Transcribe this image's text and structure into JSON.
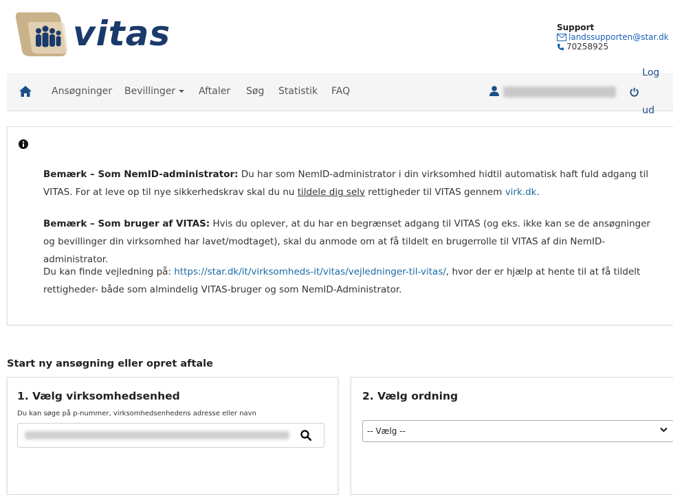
{
  "header": {
    "logo_text": "vitas",
    "support": {
      "title": "Support",
      "email": "landssupporten@star.dk",
      "phone": "70258925"
    }
  },
  "nav": {
    "items": [
      "Ansøgninger",
      "Bevillinger",
      "Aftaler",
      "Søg",
      "Statistik",
      "FAQ"
    ],
    "logout": "Log ud"
  },
  "info": {
    "p1_bold": "Bemærk – Som NemID-administrator:",
    "p1_text_a": " Du har som NemID-administrator i din virksomhed hidtil automatisk haft fuld adgang til VITAS. For at leve op til nye sikkerhedskrav skal du nu ",
    "p1_underline": "tildele dig selv",
    "p1_text_b": " rettigheder til VITAS gennem ",
    "p1_link": "virk.dk",
    "p1_end": ".",
    "p2_bold": "Bemærk – Som bruger af VITAS:",
    "p2_text": " Hvis du oplever, at du har en begrænset adgang til VITAS (og eks. ikke kan se de ansøgninger og bevillinger din virksomhed har lavet/modtaget), skal du anmode om at få tildelt en brugerrolle til VITAS af din NemID-administrator.",
    "p3_text_a": "Du kan finde vejledning på: ",
    "p3_link": "https://star.dk/it/virksomheds-it/vitas/vejledninger-til-vitas/",
    "p3_text_b": ", hvor der er hjælp at hente til at få tildelt rettigheder- både som almindelig VITAS-bruger og som NemID-Administrator."
  },
  "section": {
    "title": "Start ny ansøgning eller opret aftale",
    "card1": {
      "title": "1. Vælg virksomhedsenhed",
      "hint": "Du kan søge på p-nummer, virksomhedsenhedens adresse eller navn"
    },
    "card2": {
      "title": "2. Vælg ordning",
      "select_value": "-- Vælg --"
    }
  },
  "colors": {
    "brand_navy": "#1a3a6b",
    "link": "#1a6aa5",
    "logo_tan": "#c9b28a"
  }
}
